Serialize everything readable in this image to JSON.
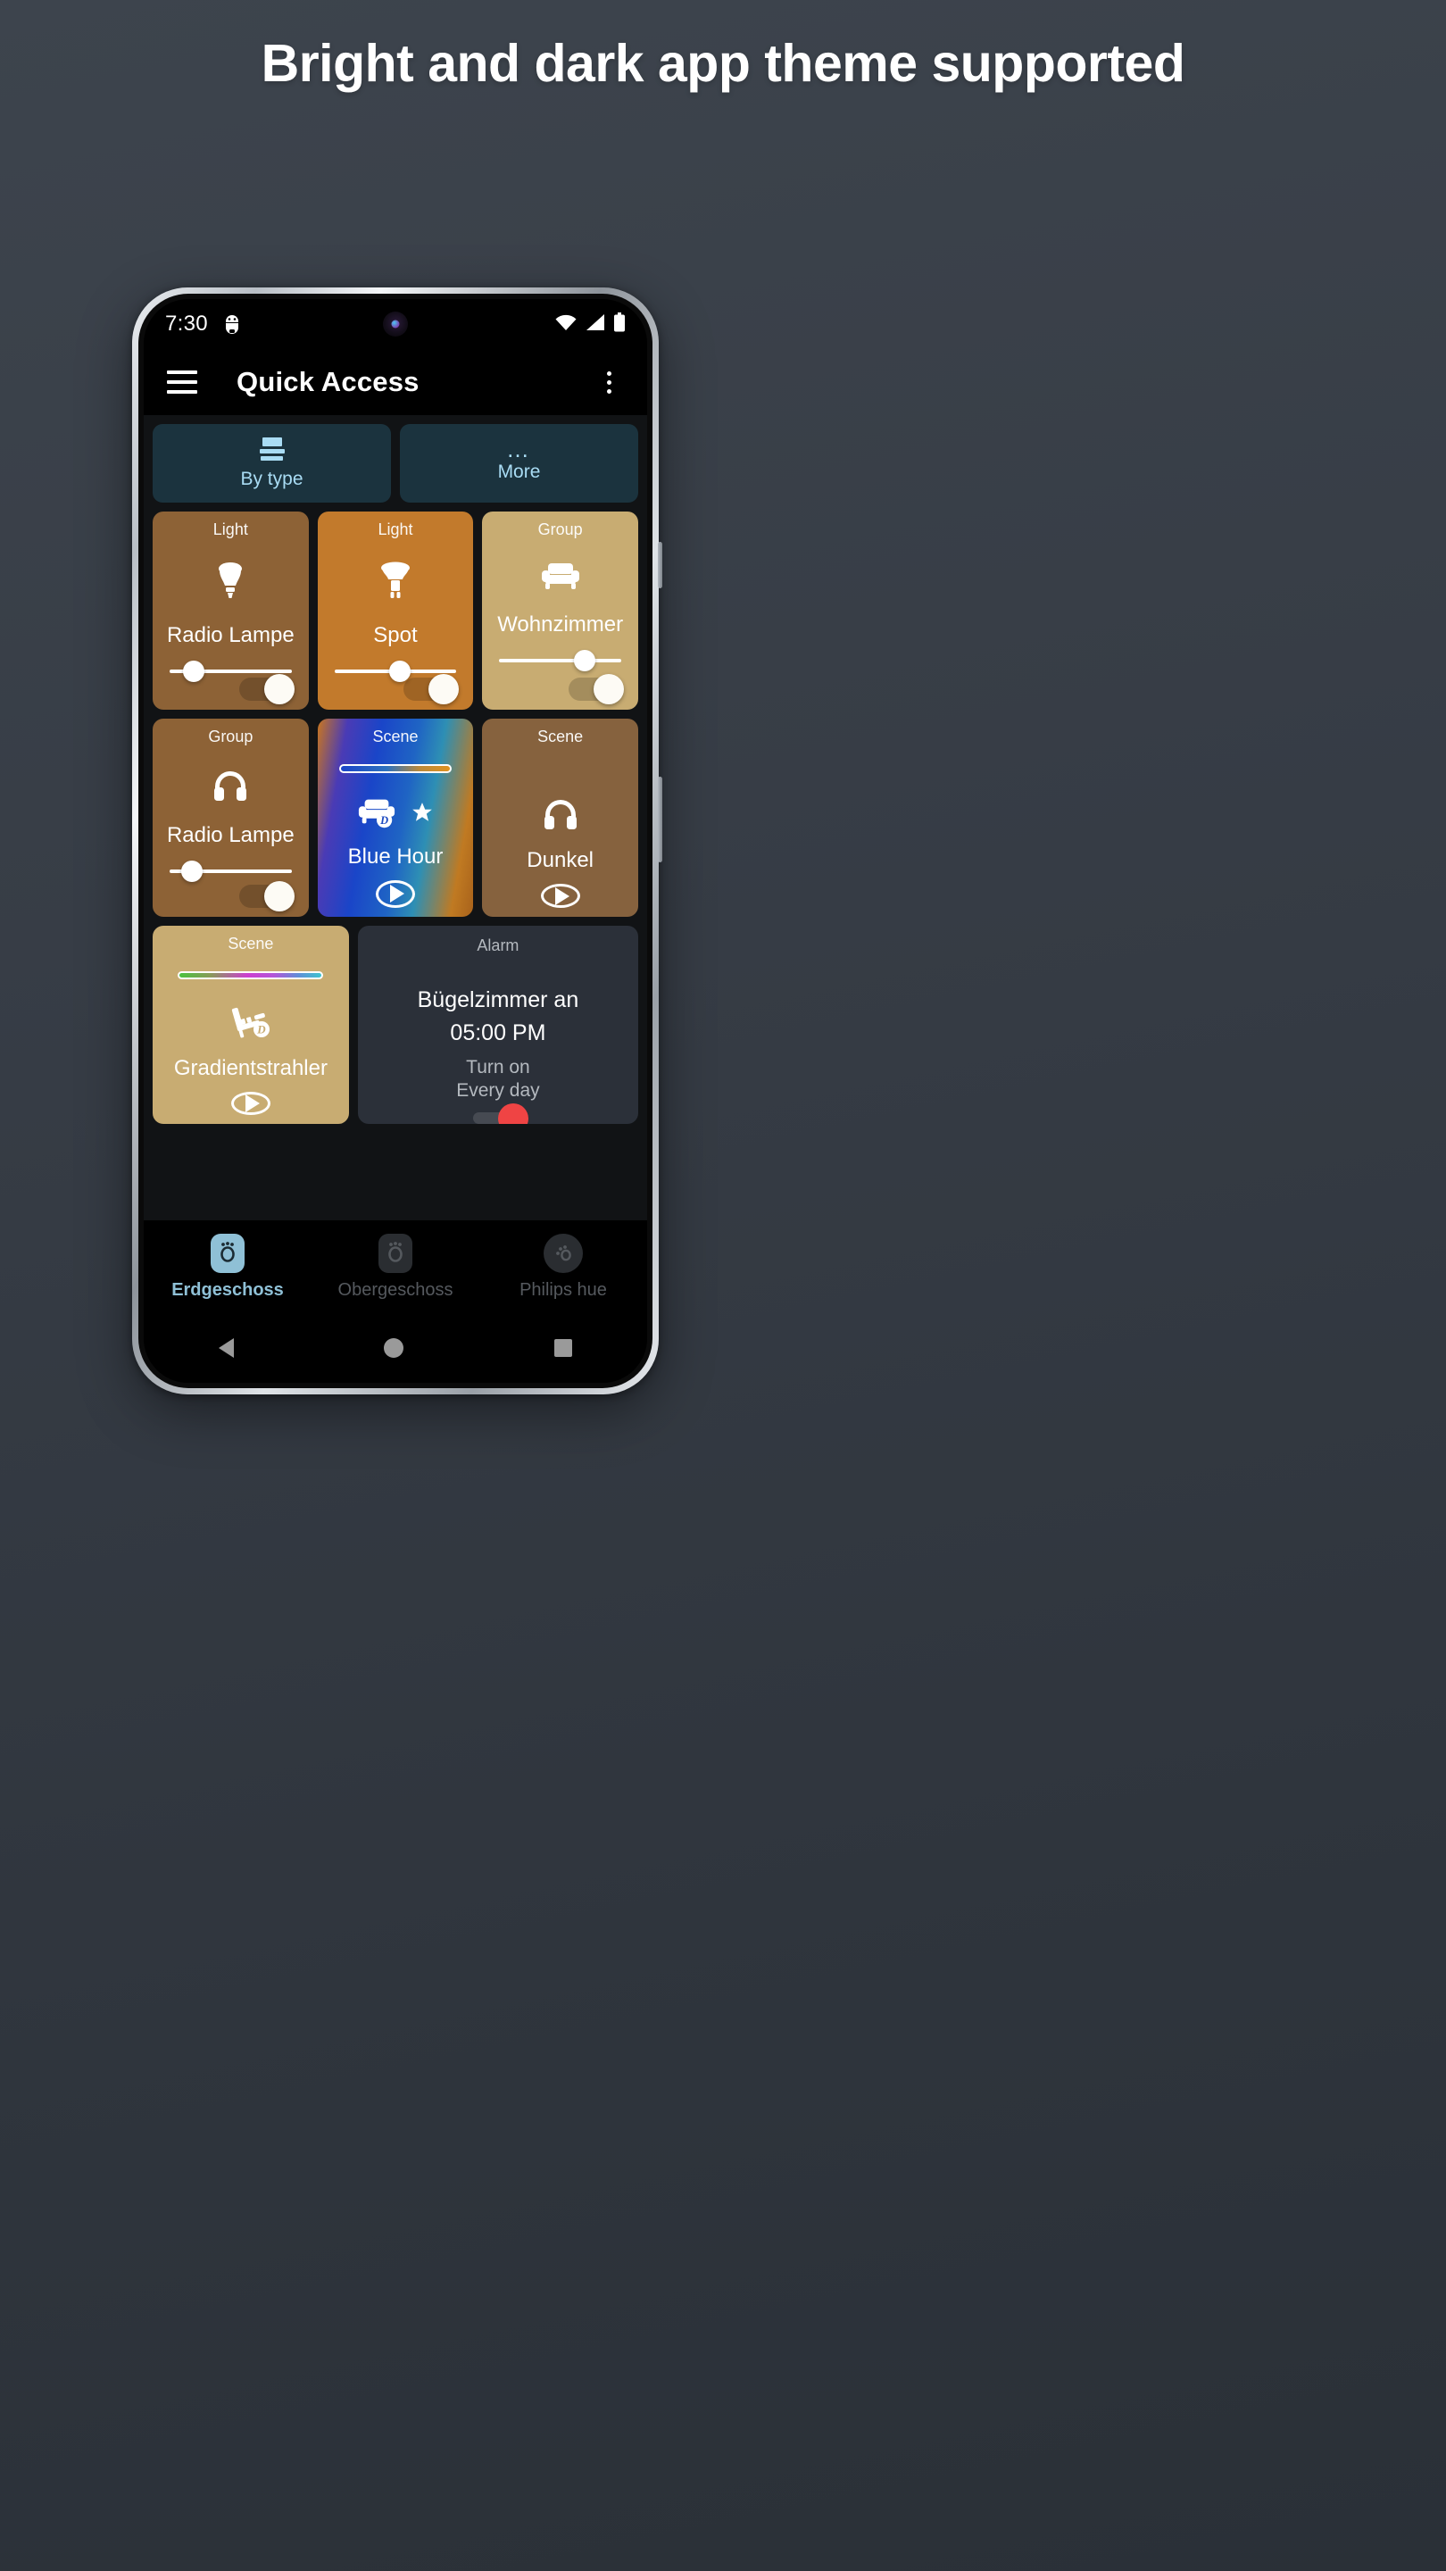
{
  "promo": {
    "headline": "Bright and dark app theme supported",
    "background_color": "#353b43"
  },
  "phone": {
    "status_bar": {
      "time": "7:30",
      "left_icon": "android-debug-icon",
      "right_icons": [
        "wifi-icon",
        "cellular-signal-icon",
        "battery-icon"
      ]
    },
    "app_bar": {
      "menu_icon": "hamburger-menu-icon",
      "title": "Quick Access",
      "overflow_icon": "overflow-menu-icon"
    },
    "filters": [
      {
        "label": "By type",
        "icon": "view-agenda-icon"
      },
      {
        "label": "More",
        "icon": "more-dots-icon"
      }
    ],
    "tiles": [
      {
        "type": "Light",
        "name": "Radio Lampe",
        "icon": "light-bulb-icon",
        "color": "#8d6236",
        "slider_percent": 20,
        "toggle_on": true,
        "kind": "device"
      },
      {
        "type": "Light",
        "name": "Spot",
        "icon": "spotlight-gu10-icon",
        "color": "#c27a2c",
        "slider_percent": 54,
        "toggle_on": true,
        "kind": "device"
      },
      {
        "type": "Group",
        "name": "Wohnzimmer",
        "icon": "sofa-icon",
        "color": "#c8ac72",
        "slider_percent": 70,
        "toggle_on": true,
        "kind": "device"
      },
      {
        "type": "Group",
        "name": "Radio Lampe",
        "icon": "headphones-icon",
        "color": "#8d6236",
        "slider_percent": 18,
        "toggle_on": true,
        "kind": "device"
      },
      {
        "type": "Scene",
        "name": "Blue Hour",
        "icon": "sofa-dynamic-icon",
        "badge_icon": "star-icon",
        "gradient": "linear-gradient(100deg,#c9761f 0%,#4a3bb5 16%,#1a45c8 34%,#1f64c4 54%,#2e8fb4 68%,#c07a22 88%,#a8621b 100%)",
        "bar_gradient": "linear-gradient(90deg,#1a44c9 0%,#2e72bd 42%,#b98a3c 72%,#e2921e 100%)",
        "kind": "scene",
        "play_icon": "play-icon"
      },
      {
        "type": "Scene",
        "name": "Dunkel",
        "icon": "headphones-icon",
        "color": "#86623e",
        "kind": "scene",
        "play_icon": "play-icon"
      }
    ],
    "bottom_row": {
      "scene": {
        "type": "Scene",
        "name": "Gradientstrahler",
        "icon": "recliner-dynamic-icon",
        "color": "#c8ac72",
        "bar_gradient": "linear-gradient(90deg,#4bc23f 0%,#8a9a5b 22%,#cc3fd0 48%,#b455d8 66%,#5f8fd8 84%,#3fc4cf 100%)",
        "kind": "scene"
      },
      "alarm": {
        "type": "Alarm",
        "title": "Bügelzimmer an",
        "time": "05:00 PM",
        "action": "Turn on",
        "repeat": "Every day",
        "toggle_color": "#ef4444"
      }
    },
    "bottom_nav": [
      {
        "label": "Erdgeschoss",
        "icon": "hue-bridge-icon",
        "active": true
      },
      {
        "label": "Obergeschoss",
        "icon": "hue-bridge-icon",
        "active": false
      },
      {
        "label": "Philips hue",
        "icon": "philips-hue-icon",
        "active": false
      }
    ],
    "system_nav": [
      "back-icon",
      "home-icon",
      "recents-icon"
    ]
  }
}
